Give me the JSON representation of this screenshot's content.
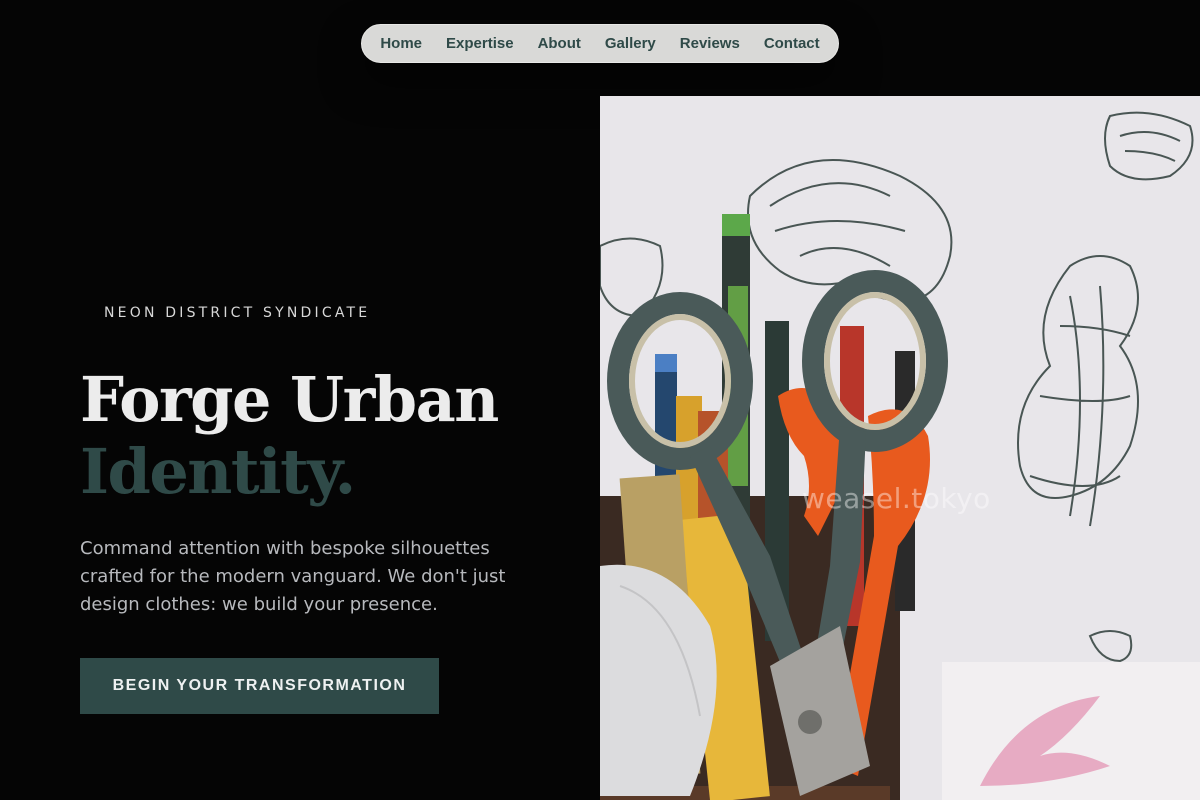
{
  "nav": {
    "items": [
      "Home",
      "Expertise",
      "About",
      "Gallery",
      "Reviews",
      "Contact"
    ]
  },
  "hero": {
    "kicker": "NEON DISTRICT SYNDICATE",
    "title_line1": "Forge Urban",
    "title_line2": "Identity.",
    "lead": "Command attention with bespoke silhouettes crafted for the modern vanguard. We don't just design clothes: we build your presence.",
    "cta_label": "BEGIN YOUR TRANSFORMATION"
  },
  "photo": {
    "watermark": "weasel.tokyo"
  },
  "colors": {
    "background": "#050505",
    "accent": "#2f4a48",
    "nav_bg": "#d9d9d7",
    "text_light": "#ececec",
    "text_muted": "#b7b9bd"
  }
}
